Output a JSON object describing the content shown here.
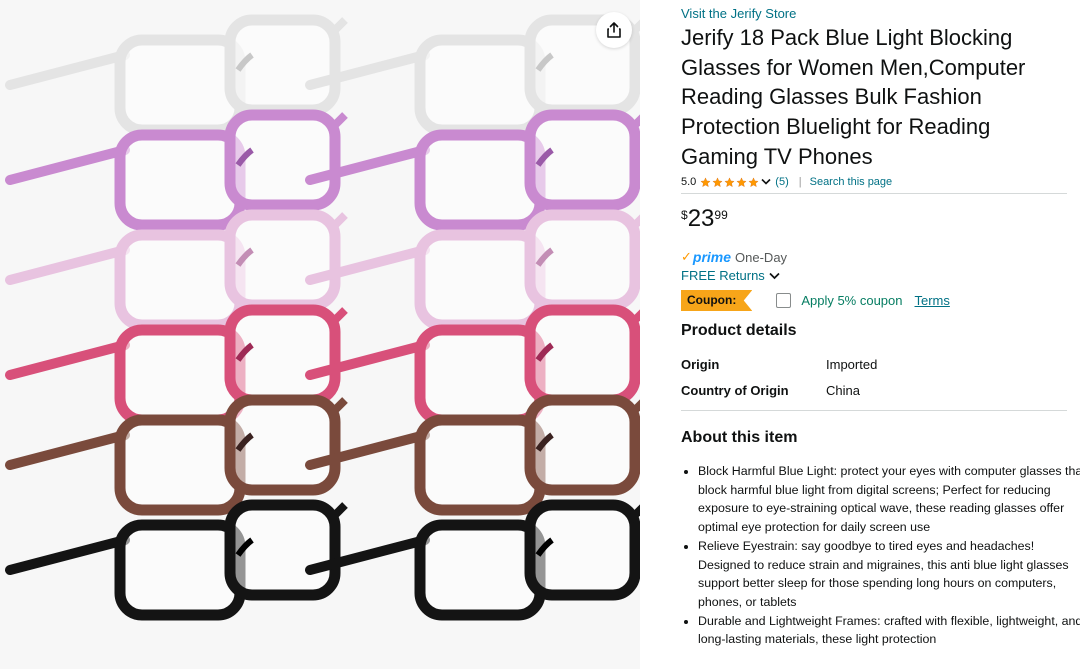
{
  "gallery": {
    "image_alt": "Eighteen pairs of blue light blocking glasses in clear, purple, pink, magenta, leopard and black frames",
    "share_icon": "share-icon"
  },
  "product": {
    "store_link": "Visit the Jerify Store",
    "title": "Jerify 18 Pack Blue Light Blocking Glasses for Women Men,Computer Reading Glasses Bulk Fashion Protection Bluelight for Reading Gaming TV Phones",
    "rating_value": "5.0",
    "stars": 5,
    "rating_count": "(5)",
    "separator": "|",
    "search_link": "Search this page",
    "price_symbol": "$",
    "price_whole": "23",
    "price_fraction": "99",
    "prime_label": "prime",
    "prime_check": "✓",
    "prime_delivery": "One-Day",
    "returns_label": "FREE Returns",
    "coupon_badge": "Coupon:",
    "coupon_text": "Apply 5% coupon",
    "coupon_terms": "Terms"
  },
  "product_details": {
    "heading": "Product details",
    "rows": [
      {
        "key": "Origin",
        "value": "Imported"
      },
      {
        "key": "Country of Origin",
        "value": "China"
      }
    ]
  },
  "about": {
    "heading": "About this item",
    "bullets": [
      "Block Harmful Blue Light: protect your eyes with computer glasses that block harmful blue light from digital screens; Perfect for reducing exposure to eye-straining optical wave, these reading glasses offer optimal eye protection for daily screen use",
      "Relieve Eyestrain: say goodbye to tired eyes and headaches! Designed to reduce strain and migraines, this anti blue light glasses support better sleep for those spending long hours on computers, phones, or tablets",
      "Durable and Lightweight Frames: crafted with flexible, lightweight, and long-lasting materials, these light protection"
    ]
  },
  "colors": {
    "link": "#007185",
    "star": "#ff9900",
    "coupon_badge": "#f7a519",
    "coupon_text": "#067d62",
    "prime_blue": "#1a98ff"
  }
}
